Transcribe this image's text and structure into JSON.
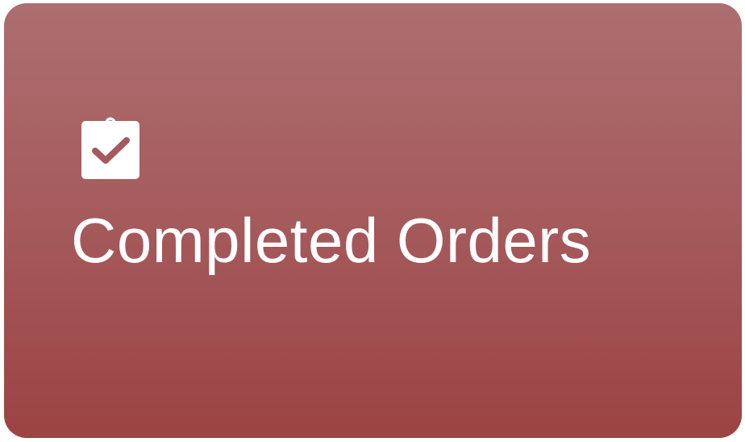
{
  "card": {
    "label": "Completed Orders",
    "icon": "clipboard-check-icon",
    "colors": {
      "gradient_top": "#ad6e70",
      "gradient_bottom": "#9c4343",
      "foreground": "#ffffff"
    }
  }
}
